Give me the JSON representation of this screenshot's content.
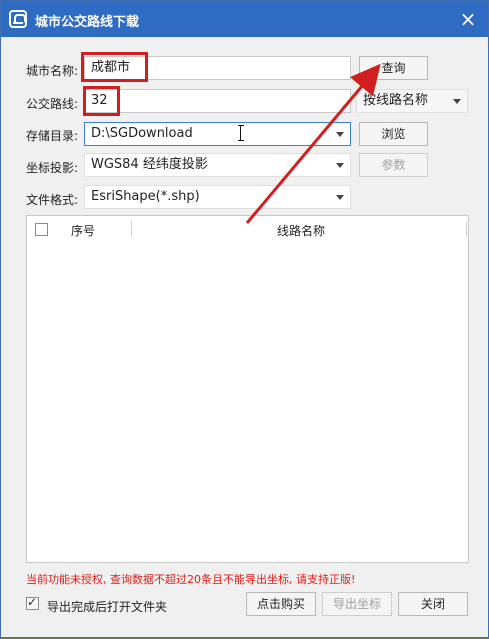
{
  "window": {
    "title": "城市公交路线下载",
    "close_glyph": "×"
  },
  "form": {
    "city": {
      "label": "城市名称:",
      "value": "成都市"
    },
    "route": {
      "label": "公交路线:",
      "value": "32"
    },
    "storage": {
      "label": "存储目录:",
      "value": "D:\\SGDownload"
    },
    "projection": {
      "label": "坐标投影:",
      "value": "WGS84 经纬度投影"
    },
    "format": {
      "label": "文件格式:",
      "value": "EsriShape(*.shp)"
    },
    "search_mode": "按线路名称"
  },
  "buttons": {
    "query": "查询",
    "browse": "浏览",
    "params": "参数",
    "buy": "点击购买",
    "export": "导出坐标",
    "close": "关闭"
  },
  "table": {
    "columns": [
      "序号",
      "线路名称"
    ],
    "rows": []
  },
  "footer": {
    "warning": "当前功能未授权, 查询数据不超过20条且不能导出坐标, 请支持正版!",
    "open_folder_label": "导出完成后打开文件夹",
    "open_folder_checked": true
  },
  "colors": {
    "titlebar": "#2e6cc4",
    "highlight": "#d11e1e",
    "warning": "#e0201a"
  }
}
